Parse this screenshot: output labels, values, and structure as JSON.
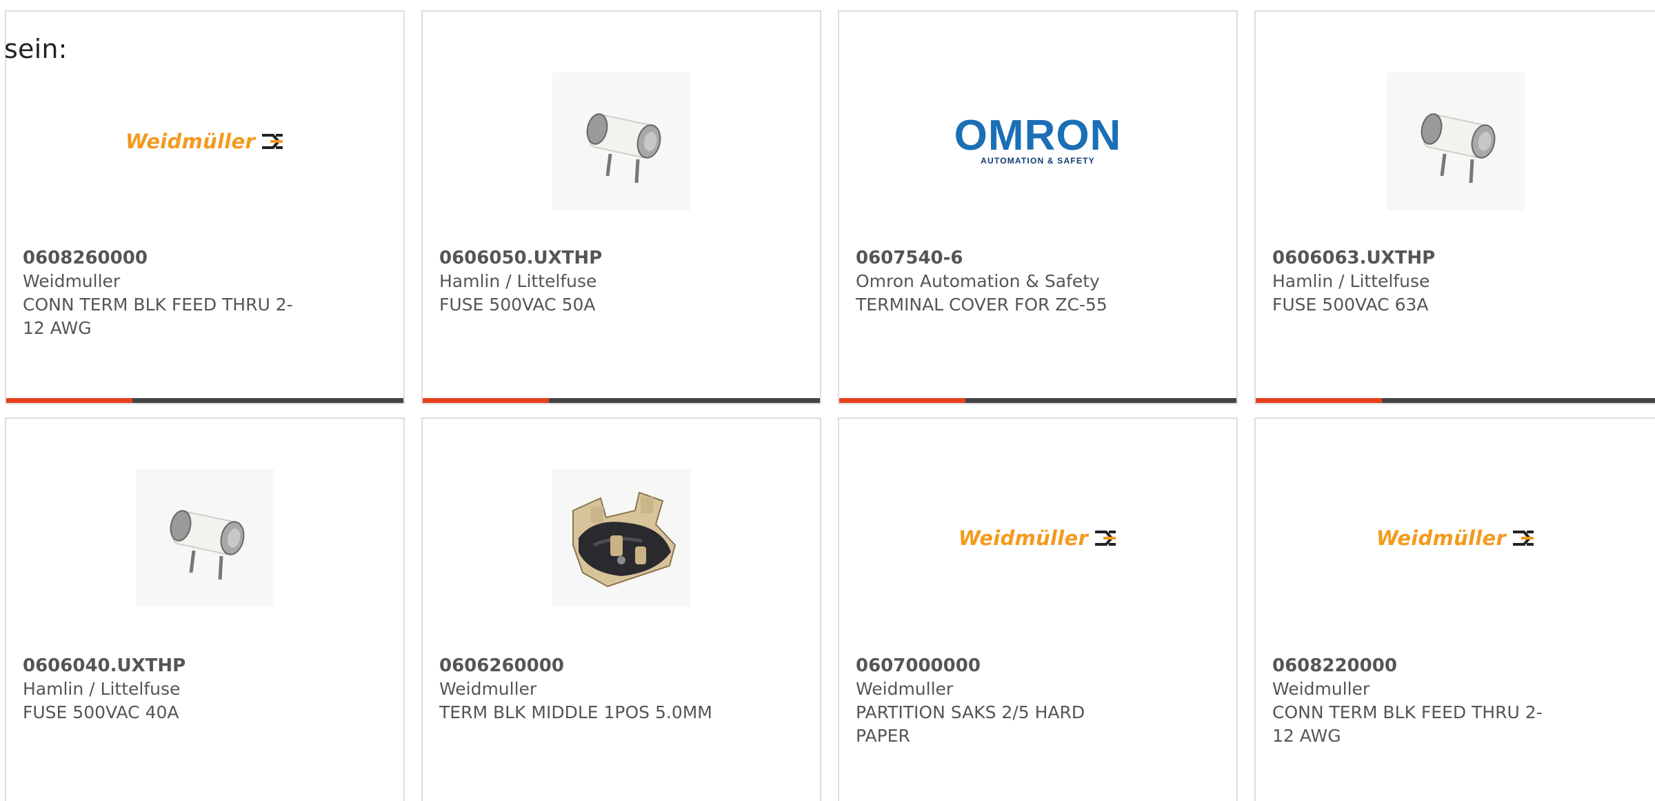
{
  "heading": "sein:",
  "brand_colors": {
    "accent_bar": "#e8401c",
    "bar": "#444444",
    "weidmuller": "#f39a1e",
    "omron": "#1a6fb5"
  },
  "products": [
    {
      "part_number": "0608260000",
      "manufacturer": "Weidmuller",
      "description": "CONN TERM BLK FEED THRU 2-\n12 AWG",
      "image": "weidmuller-logo",
      "logo_text": "Weidmüller"
    },
    {
      "part_number": "0606050.UXTHP",
      "manufacturer": "Hamlin / Littelfuse",
      "description": "FUSE 500VAC 50A",
      "image": "cartridge-fuse-photo"
    },
    {
      "part_number": "0607540-6",
      "manufacturer": "Omron Automation & Safety",
      "description": "TERMINAL COVER FOR ZC-55",
      "image": "omron-logo",
      "logo_text": "OMRON",
      "logo_subtext": "AUTOMATION & SAFETY"
    },
    {
      "part_number": "0606063.UXTHP",
      "manufacturer": "Hamlin / Littelfuse",
      "description": "FUSE 500VAC 63A",
      "image": "cartridge-fuse-photo"
    },
    {
      "part_number": "0606040.UXTHP",
      "manufacturer": "Hamlin / Littelfuse",
      "description": "FUSE 500VAC 40A",
      "image": "cartridge-fuse-photo"
    },
    {
      "part_number": "0606260000",
      "manufacturer": "Weidmuller",
      "description": "TERM BLK MIDDLE 1POS 5.0MM",
      "image": "terminal-block-photo"
    },
    {
      "part_number": "0607000000",
      "manufacturer": "Weidmuller",
      "description": "PARTITION SAKS 2/5 HARD\nPAPER",
      "image": "weidmuller-logo",
      "logo_text": "Weidmüller"
    },
    {
      "part_number": "0608220000",
      "manufacturer": "Weidmuller",
      "description": "CONN TERM BLK FEED THRU 2-\n12 AWG",
      "image": "weidmuller-logo",
      "logo_text": "Weidmüller"
    }
  ]
}
